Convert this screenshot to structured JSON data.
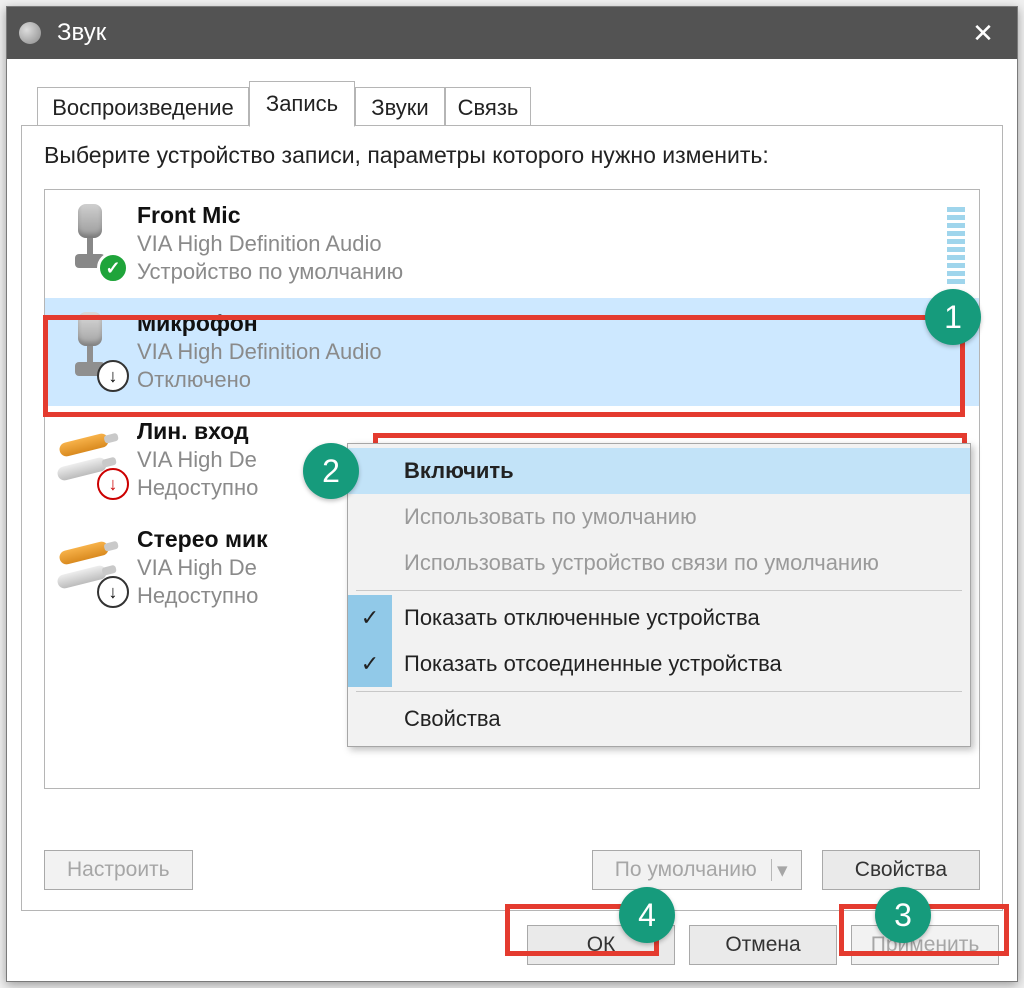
{
  "window": {
    "title": "Звук"
  },
  "tabs": [
    "Воспроизведение",
    "Запись",
    "Звуки",
    "Связь"
  ],
  "active_tab": 1,
  "prompt": "Выберите устройство записи, параметры которого нужно изменить:",
  "devices": [
    {
      "name": "Front Mic",
      "driver": "VIA High Definition Audio",
      "status": "Устройство по умолчанию",
      "icon": "mic",
      "overlay": "ok",
      "selected": false,
      "meter": true
    },
    {
      "name": "Микрофон",
      "driver": "VIA High Definition Audio",
      "status": "Отключено",
      "icon": "mic-dis",
      "overlay": "down",
      "selected": true,
      "meter": false
    },
    {
      "name": "Лин. вход",
      "driver": "VIA High Definition Audio",
      "status": "Недоступно",
      "icon": "jack",
      "overlay": "warn",
      "selected": false,
      "meter": false
    },
    {
      "name": "Стерео микшер",
      "driver": "VIA High Definition Audio",
      "status": "Недоступно",
      "icon": "jack",
      "overlay": "down",
      "selected": false,
      "meter": false
    }
  ],
  "context_menu": {
    "items": [
      {
        "label": "Включить",
        "default": true,
        "enabled": true
      },
      {
        "label": "Использовать по умолчанию",
        "default": false,
        "enabled": false
      },
      {
        "label": "Использовать устройство связи по умолчанию",
        "default": false,
        "enabled": false
      }
    ],
    "toggles": [
      {
        "label": "Показать отключенные устройства",
        "checked": true
      },
      {
        "label": "Показать отсоединенные устройства",
        "checked": true
      }
    ],
    "footer": {
      "label": "Свойства"
    }
  },
  "bottom": {
    "configure": "Настроить",
    "set_default": "По умолчанию",
    "properties": "Свойства"
  },
  "dialog_buttons": {
    "ok": "ОК",
    "cancel": "Отмена",
    "apply": "Применить"
  },
  "annotations": {
    "1": "1",
    "2": "2",
    "3": "3",
    "4": "4"
  }
}
